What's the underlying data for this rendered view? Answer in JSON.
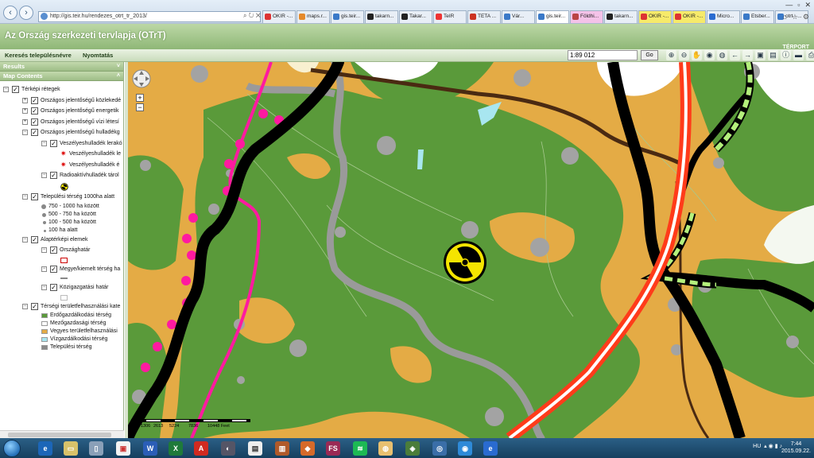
{
  "browser": {
    "address": "http://gis.teir.hu/rendezes_otrt_tr_2013/",
    "tabs": [
      {
        "label": "OKIR -...",
        "color": "#d33"
      },
      {
        "label": "maps.r...",
        "color": "#e58a2b"
      },
      {
        "label": "gis.teir...",
        "color": "#3a79c8"
      },
      {
        "label": "takarn...",
        "color": "#222"
      },
      {
        "label": "Takar...",
        "color": "#222"
      },
      {
        "label": "TeIR",
        "color": "#e33"
      },
      {
        "label": "TETA ...",
        "color": "#c32"
      },
      {
        "label": "Vár...",
        "color": "#3a79c8"
      },
      {
        "label": "gis.teir...",
        "color": "#3a79c8"
      },
      {
        "label": "Földhi...",
        "color": "#b44"
      },
      {
        "label": "takarn...",
        "color": "#222"
      },
      {
        "label": "OKIR -...",
        "color": "#d33"
      },
      {
        "label": "OKIR -...",
        "color": "#d33"
      },
      {
        "label": "Micro...",
        "color": "#2a6bd0"
      },
      {
        "label": "Etsber...",
        "color": "#3a79c8"
      },
      {
        "label": "otrt - ...",
        "color": "#3a79c8"
      }
    ]
  },
  "app": {
    "title": "Az Ország szerkezeti tervlapja (OTrT)",
    "logo": "TÉRPORT"
  },
  "toolbar": {
    "search_label": "Keresés településnévre",
    "print_label": "Nyomtatás",
    "scale_value": "1:89 012",
    "go_label": "Go"
  },
  "panels": {
    "results": "Results",
    "map_contents": "Map Contents"
  },
  "tree": {
    "root": "Térképi rétegek",
    "groups": [
      "Országos jelentőségű közlekedé",
      "Országos jelentőségű energetik",
      "Országos jelentőségű vízi létesí",
      "Országos jelentőségű hulladékg"
    ],
    "hazardous_layer": "Veszélyeshulladék lerakó",
    "hazardous_items": [
      "Veszélyeshulladék le",
      "Veszélyeshulladék é"
    ],
    "radioactive_layer": "Radioaktívhulladék tárol",
    "settlement_layer": "Települési térség 1000ha alatt",
    "settlement_legend": [
      "750 - 1000 ha között",
      "500 - 750 ha között",
      "100 - 500 ha között",
      "100 ha alatt"
    ],
    "base_layer": "Alaptérképi elemek",
    "base_items": [
      "Országhatár",
      "Megye/kiemelt térség ha",
      "Közigazgatási határ"
    ],
    "landuse_layer": "Térségi területfelhasználási kate",
    "landuse_legend": [
      {
        "label": "Erdőgazdálkodási térség",
        "color": "#5a9a3a"
      },
      {
        "label": "Mezőgazdasági térség",
        "color": "#ffffff"
      },
      {
        "label": "Vegyes területfelhasználási",
        "color": "#e4ab45"
      },
      {
        "label": "Vízgazdálkodási térség",
        "color": "#a8e6f0"
      },
      {
        "label": "Települési térség",
        "color": "#8a8a8a"
      }
    ]
  },
  "map": {
    "scalebar_ticks": [
      "0",
      "1306",
      "2613",
      "5224",
      "7836",
      "10448 Feet"
    ]
  },
  "taskbar": {
    "lang": "HU",
    "time": "7:44",
    "date": "2015.09.22."
  }
}
